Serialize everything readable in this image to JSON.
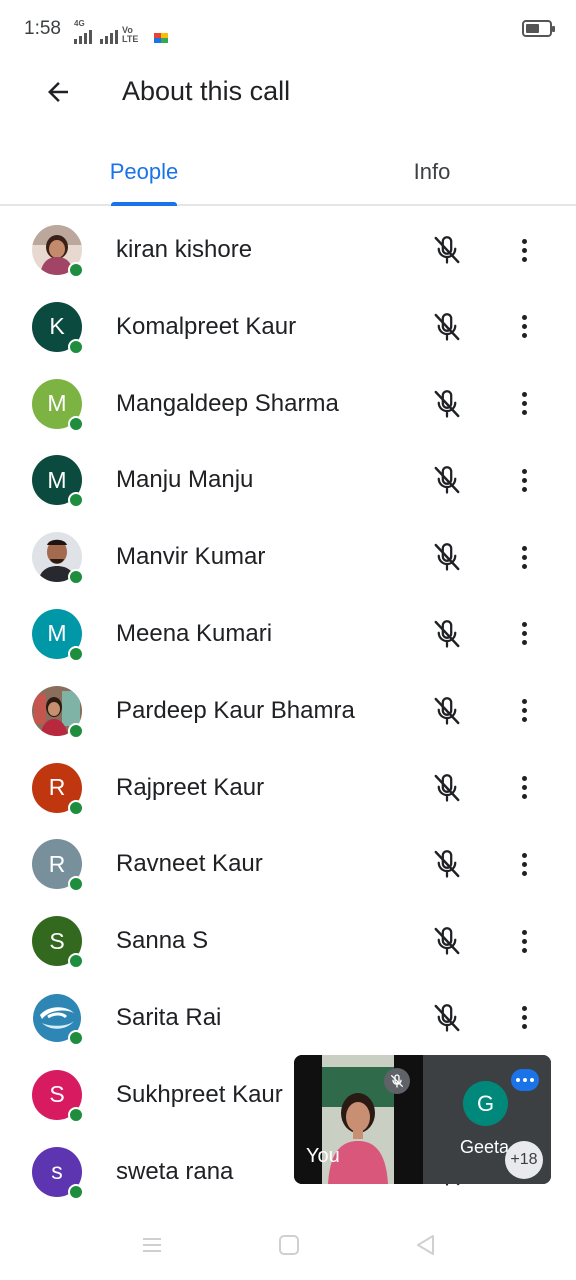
{
  "status_bar": {
    "time": "1:58",
    "network_tiny": "4G",
    "volte": "Vo LTE",
    "battery_level_percent": 60,
    "icons": [
      "signal-icon",
      "signal-icon",
      "volte-icon",
      "meet-icon",
      "battery-icon"
    ]
  },
  "header": {
    "title": "About this call",
    "back_icon": "arrow-left-icon"
  },
  "tabs": [
    {
      "label": "People",
      "selected": true
    },
    {
      "label": "Info",
      "selected": false
    }
  ],
  "colors": {
    "accent": "#1a73e8",
    "online": "#1e8e3e",
    "text": "#202124"
  },
  "participants": [
    {
      "name": "kiran kishore",
      "initial": "",
      "avatar_color": "",
      "photo": true,
      "muted": true,
      "online": true
    },
    {
      "name": "Komalpreet Kaur",
      "initial": "K",
      "avatar_color": "#0b4a3e",
      "photo": false,
      "muted": true,
      "online": true
    },
    {
      "name": "Mangaldeep Sharma",
      "initial": "M",
      "avatar_color": "#7cb342",
      "photo": false,
      "muted": true,
      "online": true
    },
    {
      "name": "Manju Manju",
      "initial": "M",
      "avatar_color": "#0b4a3e",
      "photo": false,
      "muted": true,
      "online": true
    },
    {
      "name": "Manvir Kumar",
      "initial": "",
      "avatar_color": "",
      "photo": true,
      "muted": true,
      "online": true
    },
    {
      "name": "Meena Kumari",
      "initial": "M",
      "avatar_color": "#0097a7",
      "photo": false,
      "muted": true,
      "online": true
    },
    {
      "name": "Pardeep Kaur Bhamra",
      "initial": "",
      "avatar_color": "",
      "photo": true,
      "muted": true,
      "online": true
    },
    {
      "name": "Rajpreet Kaur",
      "initial": "R",
      "avatar_color": "#c0370f",
      "photo": false,
      "muted": true,
      "online": true
    },
    {
      "name": "Ravneet Kaur",
      "initial": "R",
      "avatar_color": "#78909c",
      "photo": false,
      "muted": true,
      "online": true
    },
    {
      "name": "Sanna S",
      "initial": "S",
      "avatar_color": "#33691e",
      "photo": false,
      "muted": true,
      "online": true
    },
    {
      "name": "Sarita Rai",
      "initial": "",
      "avatar_color": "",
      "photo": true,
      "muted": true,
      "online": true
    },
    {
      "name": "Sukhpreet Kaur",
      "initial": "S",
      "avatar_color": "#d81b60",
      "photo": false,
      "muted": true,
      "online": true
    },
    {
      "name": "sweta rana",
      "initial": "s",
      "avatar_color": "#5e35b1",
      "photo": false,
      "muted": true,
      "online": true
    }
  ],
  "pip": {
    "self_label": "You",
    "other_initial": "G",
    "other_name": "Geeta",
    "other_count": "+18"
  },
  "nav_bar": {
    "icons": [
      "menu-icon",
      "home-icon",
      "back-triangle-icon"
    ]
  }
}
